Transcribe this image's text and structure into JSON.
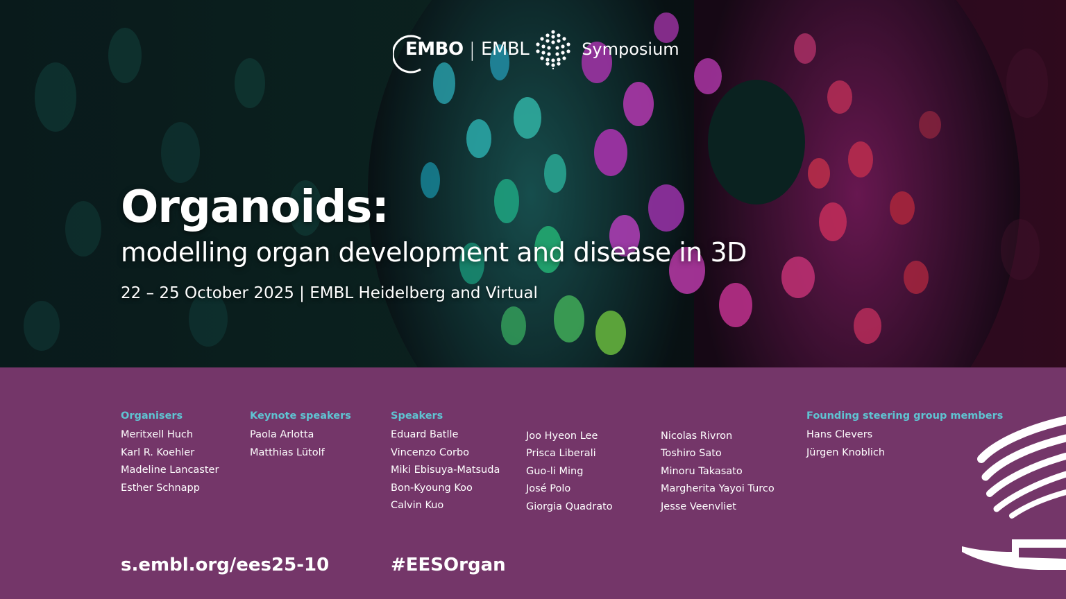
{
  "branding": {
    "embo": "EMBO",
    "separator": "|",
    "embl": "EMBL",
    "symposium": "Symposium"
  },
  "event": {
    "title": "Organoids:",
    "subtitle": "modelling organ development and disease in 3D",
    "dateline": "22 – 25 October 2025 | EMBL Heidelberg and Virtual"
  },
  "people": {
    "organisers": {
      "heading": "Organisers",
      "names": [
        "Meritxell Huch",
        "Karl R. Koehler",
        "Madeline Lancaster",
        "Esther Schnapp"
      ]
    },
    "keynote": {
      "heading": "Keynote speakers",
      "names": [
        "Paola Arlotta",
        "Matthias Lütolf"
      ]
    },
    "speakers": {
      "heading": "Speakers",
      "col1": [
        "Eduard Batlle",
        "Vincenzo Corbo",
        "Miki Ebisuya-Matsuda",
        "Bon-Kyoung Koo",
        "Calvin Kuo"
      ],
      "col2": [
        "Joo Hyeon Lee",
        "Prisca Liberali",
        "Guo-li Ming",
        "José Polo",
        "Giorgia Quadrato"
      ],
      "col3": [
        "Nicolas Rivron",
        "Toshiro Sato",
        "Minoru Takasato",
        "Margherita Yayoi Turco",
        "Jesse Veenvliet"
      ]
    },
    "steering": {
      "heading": "Founding steering group members",
      "names": [
        "Hans Clevers",
        "Jürgen Knoblich"
      ]
    }
  },
  "footer": {
    "url": "s.embl.org/ees25-10",
    "hashtag": "#EESOrgan"
  },
  "colors": {
    "panel": "#743669",
    "heading_accent": "#5fc4d2"
  }
}
